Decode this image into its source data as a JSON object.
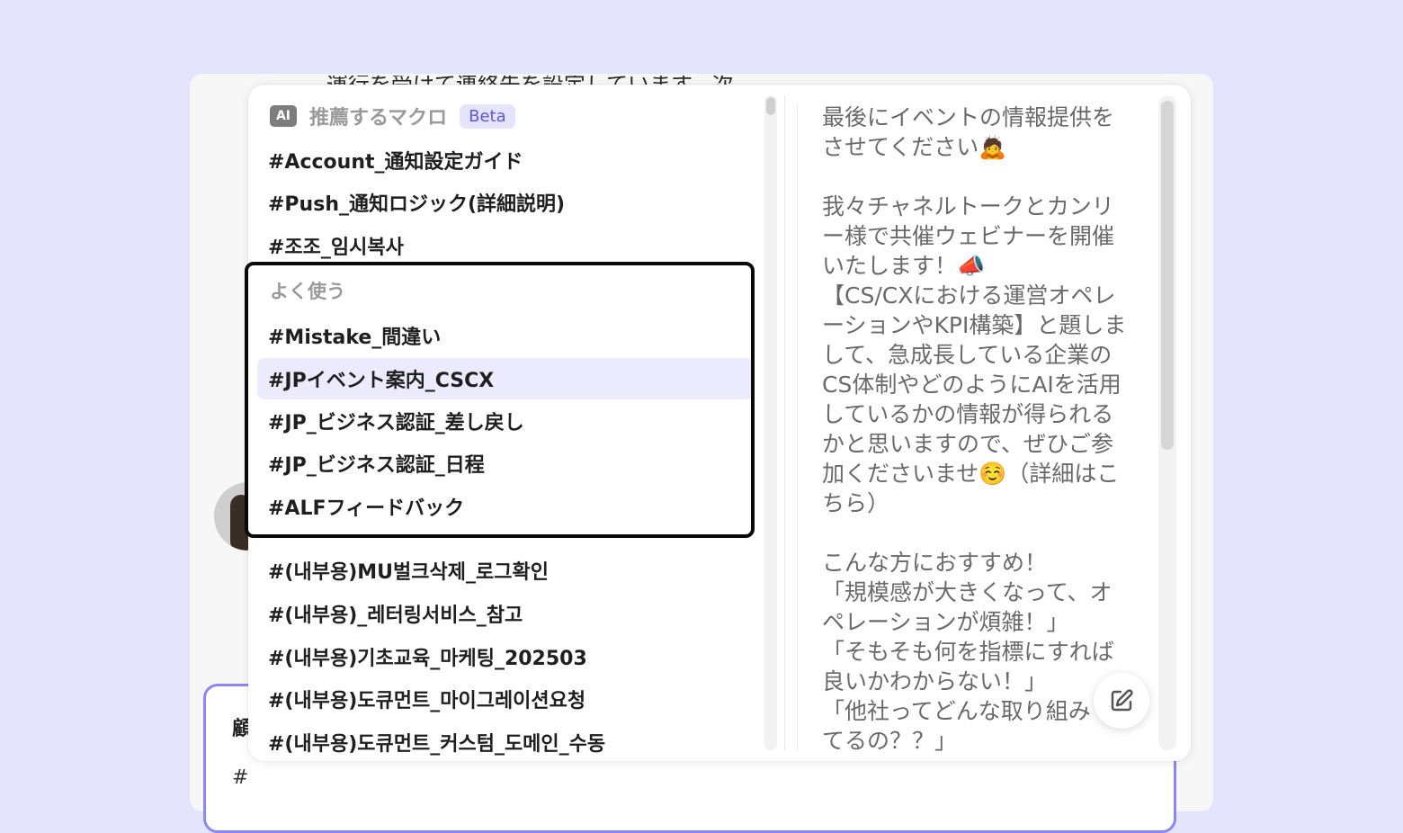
{
  "background": {
    "partial_text": "...運行を受けて連絡先を設定しています。次...",
    "composer_label": "顧",
    "composer_input": "#"
  },
  "recommended": {
    "ai_badge": "AI",
    "title": "推薦するマクロ",
    "beta": "Beta",
    "items": [
      "#Account_通知設定ガイド",
      "#Push_通知ロジック(詳細説明)",
      "#조조_임시복사"
    ]
  },
  "frequent": {
    "title": "よく使う",
    "items": [
      "#Mistake_間違い",
      "#JPイベント案内_CSCX",
      "#JP_ビジネス認証_差し戻し",
      "#JP_ビジネス認証_日程",
      "#ALFフィードバック"
    ],
    "selected": "#JPイベント案内_CSCX"
  },
  "others": {
    "items": [
      "#(내부용)MU벌크삭제_로그확인",
      "#(내부용)_레터링서비스_참고",
      "#(내부용)기초교육_마케팅_202503",
      "#(내부용)도큐먼트_마이그레이션요청",
      "#(내부용)도큐먼트_커스텀_도메인_수동"
    ]
  },
  "preview": {
    "lines": [
      "最後にイベントの情報提供を",
      "させてください🙇",
      "",
      "我々チャネルトークとカンリ",
      "ー様で共催ウェビナーを開催",
      "いたします！📣",
      "【CS/CXにおける運営オペレ",
      "ーションやKPI構築】と題しま",
      "して、急成長している企業の",
      "CS体制やどのようにAIを活用",
      "しているかの情報が得られる",
      "かと思いますので、ぜひご参",
      "加くださいませ☺️（詳細はこ",
      "ちら）",
      "",
      "こんな方におすすめ！",
      "「規模感が大きくなって、オ",
      "ペレーションが煩雑！」",
      "「そもそも何を指標にすれば",
      "良いかわからない！」",
      "「他社ってどんな取り組み",
      "てるの？？」"
    ]
  },
  "icons": {
    "edit": "pencil-edit-icon"
  }
}
